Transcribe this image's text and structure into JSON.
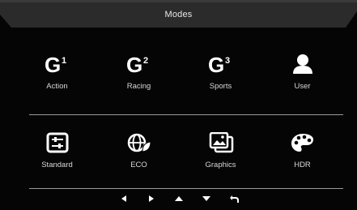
{
  "header": {
    "title": "Modes"
  },
  "modes_row1": [
    {
      "label": "Action",
      "icon": "g1-icon",
      "mark": "G",
      "sup": "1"
    },
    {
      "label": "Racing",
      "icon": "g2-icon",
      "mark": "G",
      "sup": "2"
    },
    {
      "label": "Sports",
      "icon": "g3-icon",
      "mark": "G",
      "sup": "3"
    },
    {
      "label": "User",
      "icon": "user-icon"
    }
  ],
  "modes_row2": [
    {
      "label": "Standard",
      "icon": "standard-sliders-icon"
    },
    {
      "label": "ECO",
      "icon": "eco-globe-leaf-icon"
    },
    {
      "label": "Graphics",
      "icon": "graphics-pictures-icon"
    },
    {
      "label": "HDR",
      "icon": "hdr-palette-icon"
    }
  ],
  "nav": [
    {
      "icon": "arrow-left-icon"
    },
    {
      "icon": "arrow-right-icon"
    },
    {
      "icon": "arrow-up-icon"
    },
    {
      "icon": "arrow-down-icon"
    },
    {
      "icon": "return-icon"
    }
  ],
  "colors": {
    "background": "#050505",
    "header": "#2a2a2a",
    "text": "#e6e6e6",
    "divider": "#9a9a9a"
  }
}
